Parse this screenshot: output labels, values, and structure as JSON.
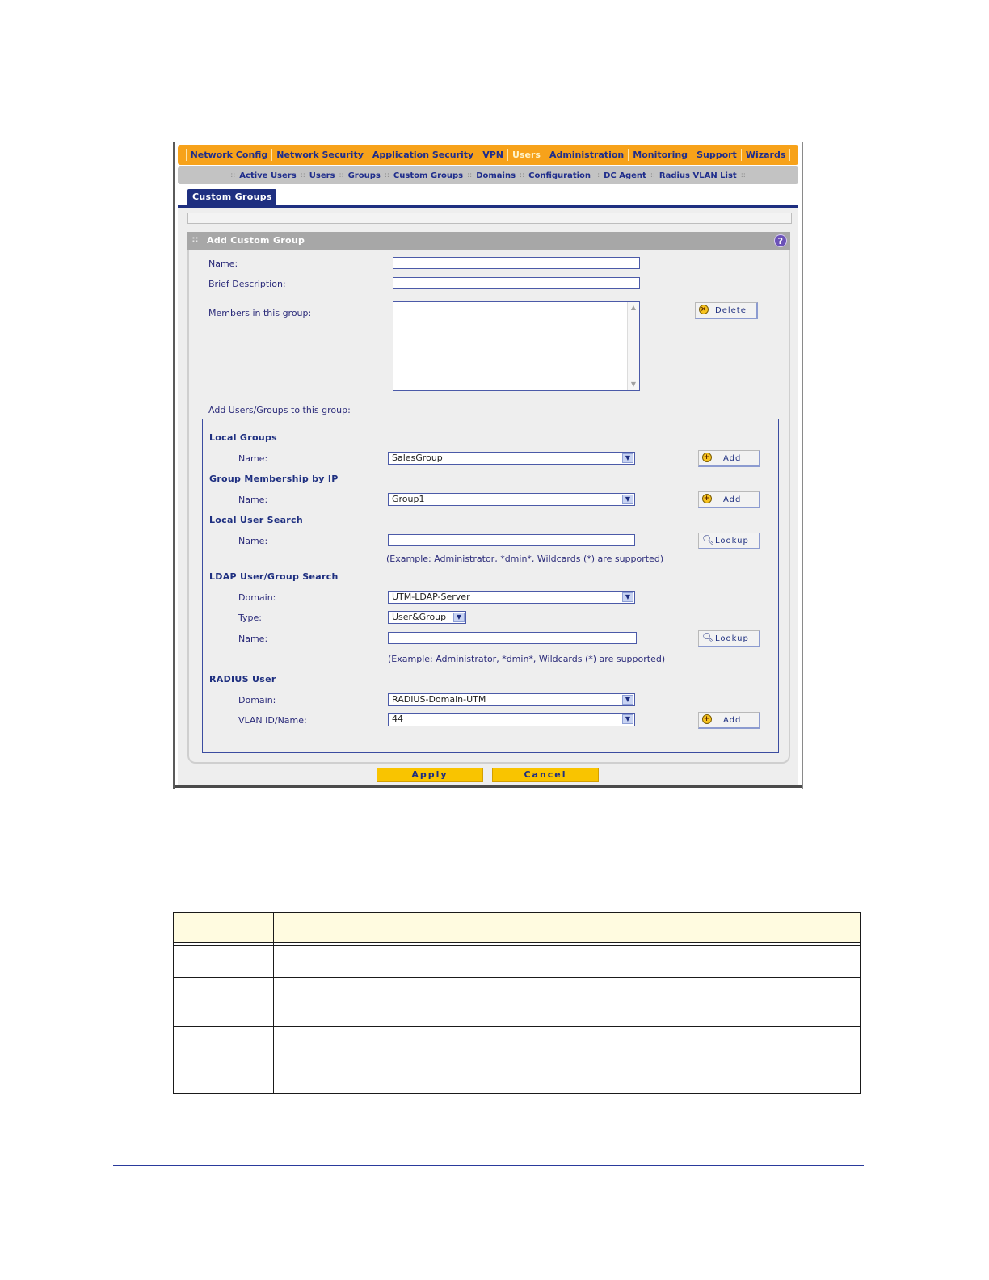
{
  "top_nav": [
    "Network Config",
    "Network Security",
    "Application Security",
    "VPN",
    "Users",
    "Administration",
    "Monitoring",
    "Support",
    "Wizards"
  ],
  "top_nav_active": "Users",
  "sub_nav": [
    "Active Users",
    "Users",
    "Groups",
    "Custom Groups",
    "Domains",
    "Configuration",
    "DC Agent",
    "Radius VLAN List"
  ],
  "page_tab": "Custom Groups",
  "section": {
    "title": "Add Custom Group",
    "help_icon": "?",
    "name_label": "Name:",
    "name_value": "",
    "description_label": "Brief Description:",
    "description_value": "",
    "members_label": "Members in this group:",
    "delete_button": "Delete",
    "add_label": "Add Users/Groups to this group:"
  },
  "local_groups": {
    "heading": "Local Groups",
    "name_label": "Name:",
    "name_value": "SalesGroup",
    "add_button": "Add"
  },
  "ip_membership": {
    "heading": "Group Membership by IP",
    "name_label": "Name:",
    "name_value": "Group1",
    "add_button": "Add"
  },
  "local_user_search": {
    "heading": "Local User Search",
    "name_label": "Name:",
    "name_value": "",
    "lookup_button": "Lookup",
    "hint": "(Example: Administrator, *dmin*, Wildcards (*) are supported)"
  },
  "ldap_search": {
    "heading": "LDAP User/Group Search",
    "domain_label": "Domain:",
    "domain_value": "UTM-LDAP-Server",
    "type_label": "Type:",
    "type_value": "User&Group",
    "name_label": "Name:",
    "name_value": "",
    "lookup_button": "Lookup",
    "hint": "(Example: Administrator, *dmin*, Wildcards (*) are supported)"
  },
  "radius_user": {
    "heading": "RADIUS User",
    "domain_label": "Domain:",
    "domain_value": "RADIUS-Domain-UTM",
    "vlan_label": "VLAN ID/Name:",
    "vlan_value": "44",
    "add_button": "Add"
  },
  "actions": {
    "apply": "Apply",
    "cancel": "Cancel"
  },
  "colors": {
    "nav_orange": "#f7a21a",
    "nav_text": "#1f2d8c",
    "tab_blue": "#1e2f80",
    "button_yellow": "#f9c400",
    "table_header": "#fffbe0"
  }
}
